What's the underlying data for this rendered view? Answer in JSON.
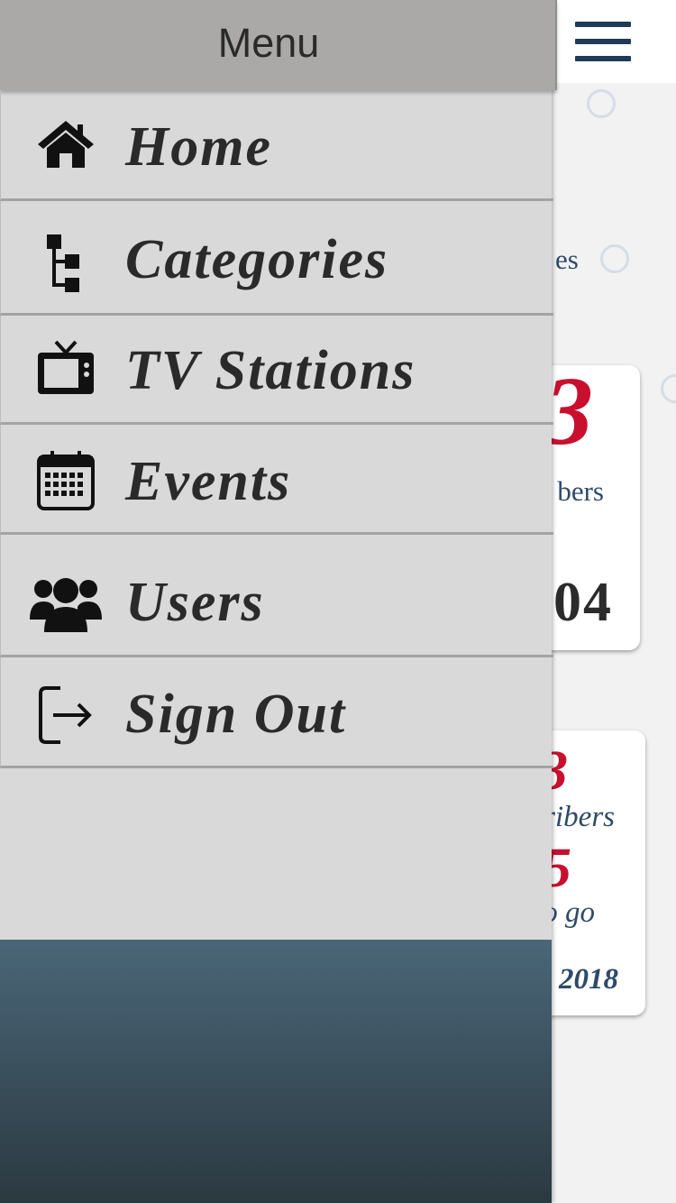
{
  "drawer": {
    "title": "Menu",
    "items": [
      {
        "label": "Home",
        "icon": "home-icon"
      },
      {
        "label": "Categories",
        "icon": "sitemap-icon"
      },
      {
        "label": "TV Stations",
        "icon": "tv-icon"
      },
      {
        "label": "Events",
        "icon": "calendar-icon"
      },
      {
        "label": "Users",
        "icon": "users-icon"
      },
      {
        "label": "Sign Out",
        "icon": "sign-out-icon"
      }
    ]
  },
  "background": {
    "tab_text": "es",
    "card1": {
      "number": "3",
      "label": "bers",
      "big": "04"
    },
    "card2": {
      "number": "3",
      "label": "ribers",
      "number2": "5",
      "go": "o go",
      "date": "2018"
    }
  },
  "colors": {
    "accent": "#c8102e",
    "navy": "#1f3a57",
    "drawer_bg": "#d9d9d9",
    "header_bg": "#aaa9a7"
  }
}
